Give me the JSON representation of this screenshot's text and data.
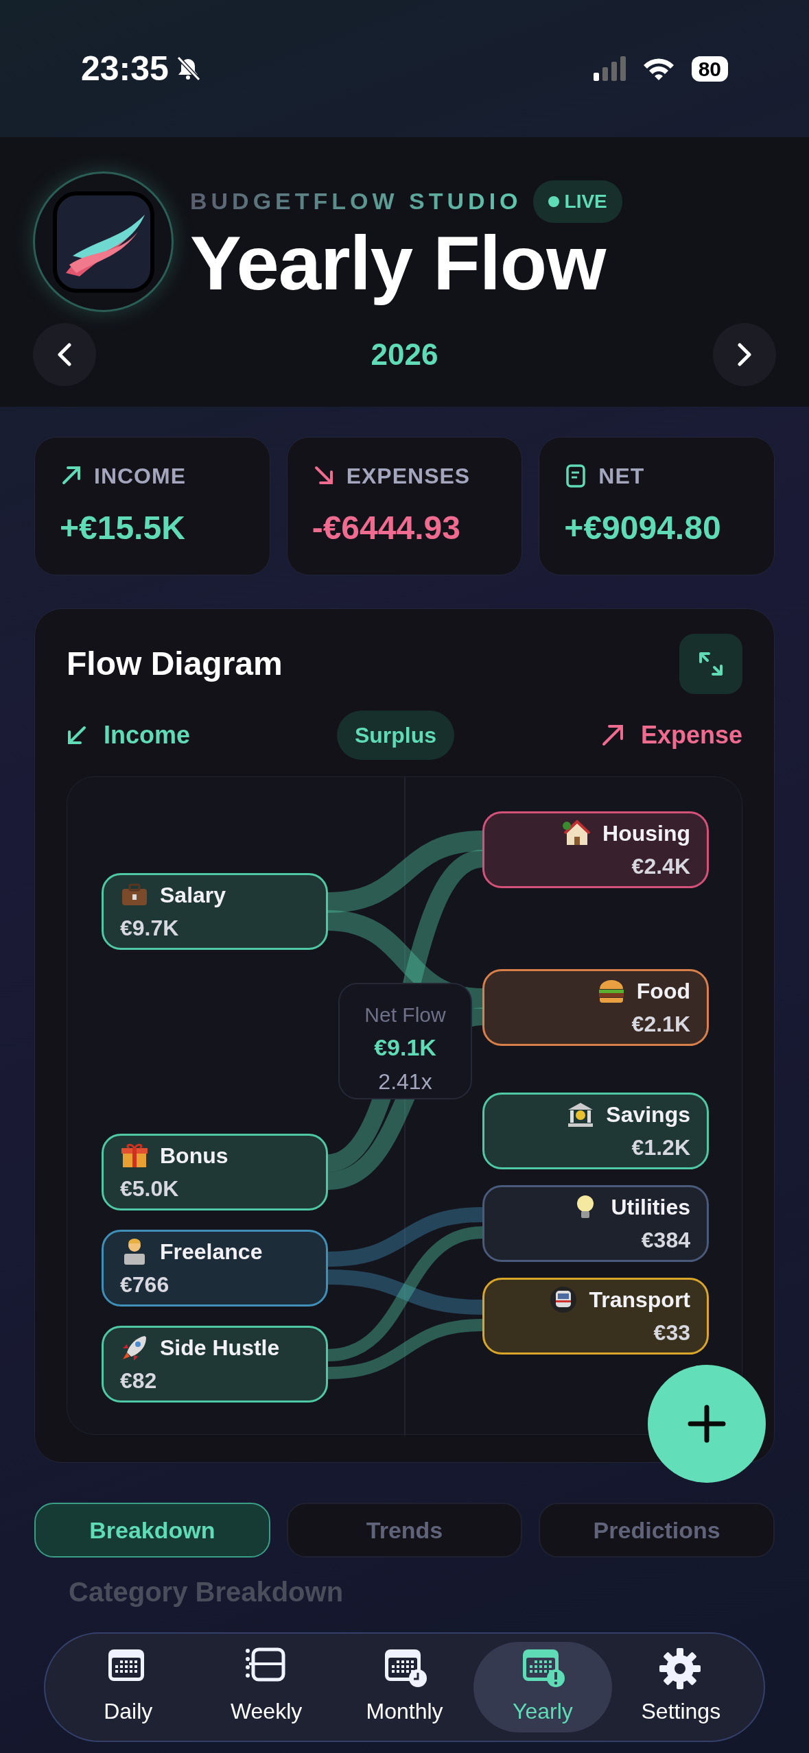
{
  "status_bar": {
    "time": "23:35",
    "battery": "80"
  },
  "header": {
    "brand": "BUDGETFLOW STUDIO",
    "badge": "LIVE",
    "title": "Yearly Flow",
    "year": "2026"
  },
  "stats": [
    {
      "kind": "income",
      "label": "INCOME",
      "value": "+€15.5K"
    },
    {
      "kind": "expense",
      "label": "EXPENSES",
      "value": "-€6444.93"
    },
    {
      "kind": "net",
      "label": "NET",
      "value": "+€9094.80"
    }
  ],
  "flow_diagram": {
    "title": "Flow Diagram",
    "legend_income": "Income",
    "status": "Surplus",
    "legend_expense": "Expense",
    "net_flow": {
      "label": "Net Flow",
      "value": "€9.1K",
      "ratio": "2.41x"
    },
    "sources": [
      {
        "name": "Salary",
        "amount": "€9.7K",
        "color": "#4fc9a4"
      },
      {
        "name": "Bonus",
        "amount": "€5.0K",
        "color": "#4fc9a4"
      },
      {
        "name": "Freelance",
        "amount": "€766",
        "color": "#3f8fb8"
      },
      {
        "name": "Side Hustle",
        "amount": "€82",
        "color": "#4fc9a4"
      }
    ],
    "targets": [
      {
        "name": "Housing",
        "amount": "€2.4K",
        "color": "#d4527a"
      },
      {
        "name": "Food",
        "amount": "€2.1K",
        "color": "#d9804a"
      },
      {
        "name": "Savings",
        "amount": "€1.2K",
        "color": "#4fc9a4"
      },
      {
        "name": "Utilities",
        "amount": "€384",
        "color": "#4a5a7a"
      },
      {
        "name": "Transport",
        "amount": "€33",
        "color": "#d9a62a"
      }
    ]
  },
  "section_tabs": [
    {
      "label": "Breakdown",
      "selected": true
    },
    {
      "label": "Trends",
      "selected": false
    },
    {
      "label": "Predictions",
      "selected": false
    }
  ],
  "section_title": "Category Breakdown",
  "nav": [
    {
      "label": "Daily",
      "selected": false
    },
    {
      "label": "Weekly",
      "selected": false
    },
    {
      "label": "Monthly",
      "selected": false
    },
    {
      "label": "Yearly",
      "selected": true
    },
    {
      "label": "Settings",
      "selected": false
    }
  ]
}
